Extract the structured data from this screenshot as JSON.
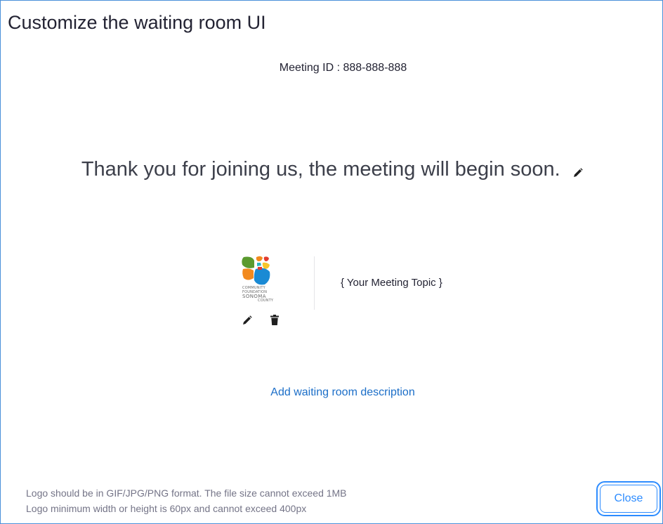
{
  "dialog": {
    "title": "Customize the waiting room UI"
  },
  "meeting": {
    "id_label": "Meeting ID :",
    "id_value": "888-888-888"
  },
  "welcome": {
    "text": "Thank you for joining us, the meeting will begin soon.",
    "edit_icon": "pencil-icon"
  },
  "logo": {
    "lines": [
      "COMMUNITY",
      "FOUNDATION",
      "SONOMA",
      "COUNTY"
    ],
    "colors": {
      "green": "#5a9a2e",
      "orange": "#f28a1e",
      "red": "#e23b2e",
      "yellow": "#f7c52b",
      "blue": "#1a8ad4",
      "teal": "#2bb3c0"
    },
    "edit_icon": "pencil-icon",
    "delete_icon": "trash-icon"
  },
  "topic": {
    "text": "{ Your Meeting Topic }"
  },
  "description": {
    "add_link": "Add waiting room description"
  },
  "notes": {
    "line1": "Logo should be in GIF/JPG/PNG format. The file size cannot exceed 1MB",
    "line2": "Logo minimum width or height is 60px and cannot exceed 400px"
  },
  "footer": {
    "close_label": "Close"
  },
  "theme": {
    "accent": "#2d8cff",
    "link": "#1b6ec8",
    "border": "#4a90d9"
  }
}
